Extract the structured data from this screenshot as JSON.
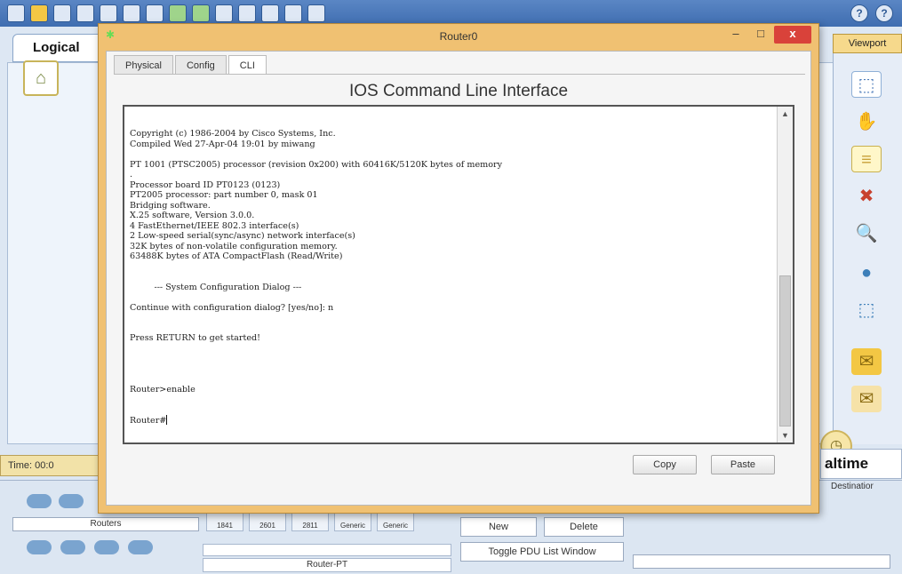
{
  "app": {
    "logical_tab": "Logical",
    "viewport_tab": "Viewport",
    "time_label": "Time: 00:0",
    "realtime_label": "altime",
    "destination_header": "Destinatior",
    "device_category": "Routers",
    "device_models": [
      "1841",
      "2601",
      "2811",
      "Generic",
      "Generic"
    ],
    "device_name": "Router-PT",
    "pdu_new": "New",
    "pdu_delete": "Delete",
    "toggle_pdu": "Toggle PDU List Window",
    "help_icons": [
      "?",
      "?"
    ]
  },
  "router_window": {
    "title": "Router0",
    "minimize": "–",
    "maximize": "□",
    "close": "x",
    "tabs": [
      "Physical",
      "Config",
      "CLI"
    ],
    "active_tab": "CLI",
    "heading": "IOS Command Line Interface",
    "terminal_lines": [
      "Copyright (c) 1986-2004 by Cisco Systems, Inc.",
      "Compiled Wed 27-Apr-04 19:01 by miwang",
      "",
      "PT 1001 (PTSC2005) processor (revision 0x200) with 60416K/5120K bytes of memory",
      ".",
      "Processor board ID PT0123 (0123)",
      "PT2005 processor: part number 0, mask 01",
      "Bridging software.",
      "X.25 software, Version 3.0.0.",
      "4 FastEthernet/IEEE 802.3 interface(s)",
      "2 Low-speed serial(sync/async) network interface(s)",
      "32K bytes of non-volatile configuration memory.",
      "63488K bytes of ATA CompactFlash (Read/Write)",
      "",
      "",
      "         --- System Configuration Dialog ---",
      "",
      "Continue with configuration dialog? [yes/no]: n",
      "",
      "",
      "Press RETURN to get started!",
      "",
      "",
      "",
      "",
      "Router>enable"
    ],
    "prompt_line": "Router#",
    "copy_button": "Copy",
    "paste_button": "Paste"
  },
  "colors": {
    "window_frame": "#f0c172",
    "close_button": "#d9423a",
    "toolbar": "#3f6db0"
  }
}
